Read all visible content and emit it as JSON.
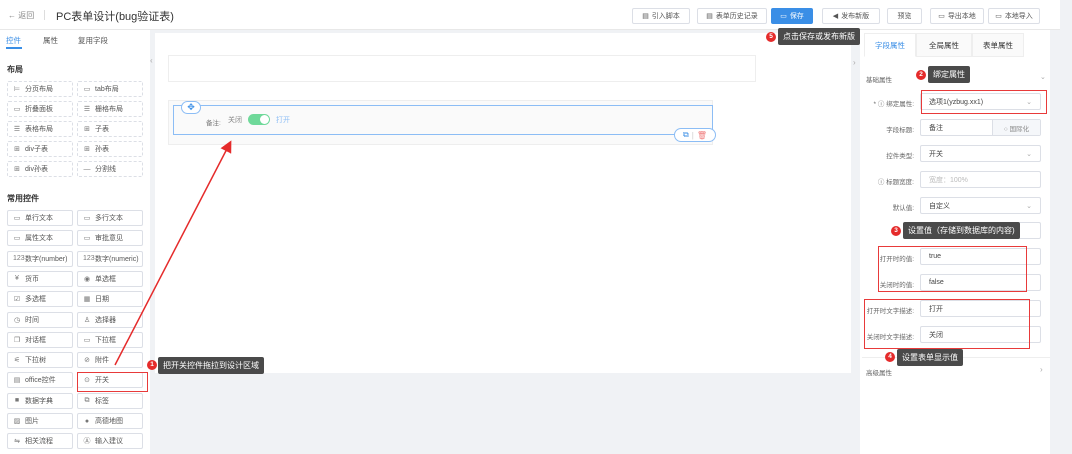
{
  "header": {
    "back": "← 返回",
    "title": "PC表单设计(bug验证表)",
    "buttons": [
      {
        "icon": "▤",
        "label": "引入脚本"
      },
      {
        "icon": "▤",
        "label": "表单历史记录"
      },
      {
        "icon": "▭",
        "label": "保存"
      },
      {
        "icon": "◀",
        "label": "发布新版"
      },
      {
        "icon": "",
        "label": "预览"
      },
      {
        "icon": "▭",
        "label": "导出本地"
      },
      {
        "icon": "▭",
        "label": "本地导入"
      }
    ]
  },
  "left": {
    "tabs": [
      "控件",
      "属性",
      "复用字段"
    ],
    "layout_title": "布局",
    "layout": [
      {
        "icon": "⊨",
        "label": "分页布局"
      },
      {
        "icon": "▭",
        "label": "tab布局"
      },
      {
        "icon": "▭",
        "label": "折叠面板"
      },
      {
        "icon": "☰",
        "label": "栅格布局"
      },
      {
        "icon": "☰",
        "label": "表格布局"
      },
      {
        "icon": "⊞",
        "label": "子表"
      },
      {
        "icon": "⊞",
        "label": "div子表"
      },
      {
        "icon": "⊞",
        "label": "孙表"
      },
      {
        "icon": "⊞",
        "label": "div孙表"
      },
      {
        "icon": "—",
        "label": "分割线"
      }
    ],
    "common_title": "常用控件",
    "common": [
      {
        "icon": "▭",
        "label": "单行文本"
      },
      {
        "icon": "▭",
        "label": "多行文本"
      },
      {
        "icon": "▭",
        "label": "属性文本"
      },
      {
        "icon": "▭",
        "label": "审批意见"
      },
      {
        "icon": "123",
        "label": "数字(number)"
      },
      {
        "icon": "123",
        "label": "数字(numeric)"
      },
      {
        "icon": "¥",
        "label": "货币"
      },
      {
        "icon": "◉",
        "label": "单选框"
      },
      {
        "icon": "☑",
        "label": "多选框"
      },
      {
        "icon": "▦",
        "label": "日期"
      },
      {
        "icon": "◷",
        "label": "时间"
      },
      {
        "icon": "♙",
        "label": "选择器"
      },
      {
        "icon": "❐",
        "label": "对话框"
      },
      {
        "icon": "▭",
        "label": "下拉框"
      },
      {
        "icon": "⚟",
        "label": "下拉树"
      },
      {
        "icon": "⊘",
        "label": "附件"
      },
      {
        "icon": "▤",
        "label": "office控件"
      },
      {
        "icon": "⊙",
        "label": "开关"
      },
      {
        "icon": "■",
        "label": "数据字典"
      },
      {
        "icon": "⧉",
        "label": "标签"
      },
      {
        "icon": "▨",
        "label": "图片"
      },
      {
        "icon": "●",
        "label": "高德地图"
      },
      {
        "icon": "⇋",
        "label": "相关流程"
      },
      {
        "icon": "Ⓐ",
        "label": "输入建议"
      }
    ]
  },
  "canvas": {
    "field_label": "备注:",
    "off_text": "关闭",
    "on_text": "打开",
    "switch_on": true
  },
  "right": {
    "tabs": [
      "字段属性",
      "全局属性",
      "表单属性"
    ],
    "section": "基础属性",
    "advanced": "高级属性",
    "fields": [
      {
        "label": "* ⓘ 绑定属性:",
        "value": "选项1(yzbug.xx1)"
      },
      {
        "label": "字段标题:",
        "value": "备注",
        "extra": "○ 国际化"
      },
      {
        "label": "控件类型:",
        "value": "开关"
      },
      {
        "label": "ⓘ 标题宽度:",
        "placeholder": "宽度：100%"
      },
      {
        "label": "默认值:",
        "value": "自定义"
      },
      {
        "label": "",
        "value": ""
      },
      {
        "label": "打开时的值:",
        "value": "true"
      },
      {
        "label": "关闭时的值:",
        "value": "false"
      },
      {
        "label": "打开时文字描述:",
        "value": "打开"
      },
      {
        "label": "关闭时文字描述:",
        "value": "关闭"
      }
    ]
  },
  "callouts": [
    {
      "n": "1",
      "text": "把开关控件拖拉到设计区域"
    },
    {
      "n": "2",
      "text": "绑定属性"
    },
    {
      "n": "3",
      "text": "设置值（存储到数据库的内容)"
    },
    {
      "n": "4",
      "text": "设置表单显示值"
    },
    {
      "n": "5",
      "text": "点击保存或发布新版"
    }
  ],
  "colors": {
    "accent": "#3a8ee6",
    "annotation": "#e52b2b",
    "switch": "#6fd99a"
  }
}
